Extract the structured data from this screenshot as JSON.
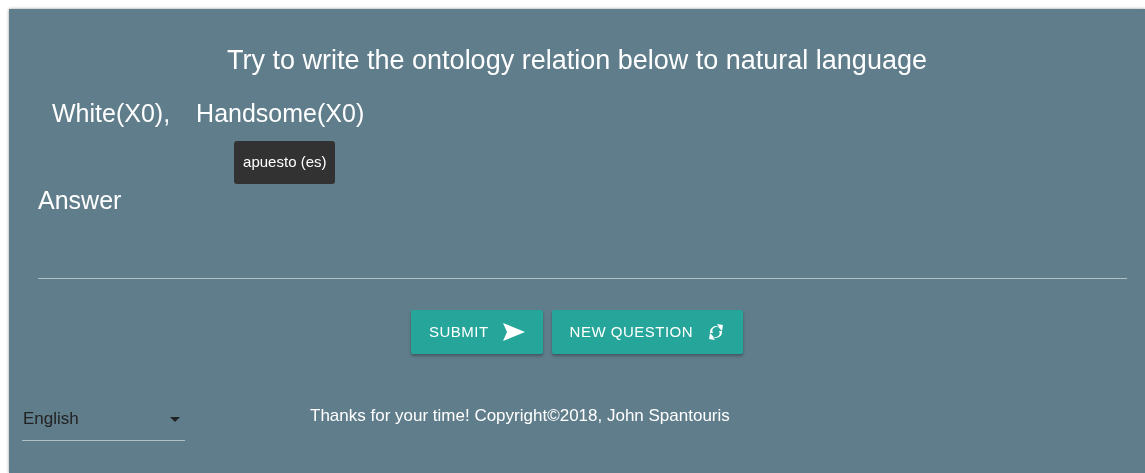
{
  "prompt": "Try to write the ontology relation below to natural language",
  "terms": [
    {
      "text": "White(X0),"
    },
    {
      "text": "Handsome(X0)",
      "tooltip": "apuesto (es)"
    }
  ],
  "answer": {
    "label": "Answer"
  },
  "buttons": [
    {
      "label": "SUBMIT"
    },
    {
      "label": "NEW QUESTION"
    }
  ],
  "language": {
    "value": "English"
  },
  "footer": "Thanks for your time! Copyright©2018, John Spantouris"
}
